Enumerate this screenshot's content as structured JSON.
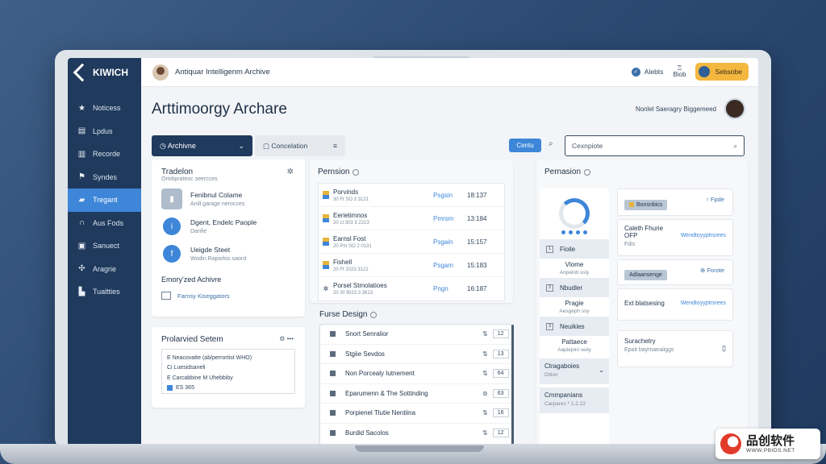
{
  "topbar": {
    "app_title": "Antiquar Intelligenm Archive",
    "link_label": "Alebts",
    "bell_label": "Biob",
    "pill_label": "Sebsobe"
  },
  "sidebar": {
    "logo": "KIWICH",
    "items": [
      {
        "label": "Noticess",
        "icon": "star-icon"
      },
      {
        "label": "Lpdus",
        "icon": "document-icon"
      },
      {
        "label": "Recorde",
        "icon": "book-icon"
      },
      {
        "label": "Syndes",
        "icon": "flag-icon"
      },
      {
        "label": "Tregant",
        "icon": "folder-icon",
        "active": true
      },
      {
        "label": "Aus Fods",
        "icon": "arch-icon"
      },
      {
        "label": "Sanuect",
        "icon": "calendar-icon"
      },
      {
        "label": "Aragrie",
        "icon": "settings-icon"
      },
      {
        "label": "Tualtties",
        "icon": "printer-icon"
      }
    ]
  },
  "header": {
    "title": "Arttimoorgy Archare",
    "user_text": "Nonlel Saeragry Biggemeed"
  },
  "toolbar": {
    "dropdown_label": "Archivne",
    "tab_label": "Concelation",
    "button_label": "Centu",
    "search_placeholder": "Cexnpiote"
  },
  "card_tradelon": {
    "title": "Tradelon",
    "subtitle": "Omitiprateoc seercces",
    "items": [
      {
        "title": "Fenibnul Colame",
        "sub": "Anill garage nerocces"
      },
      {
        "title": "Dgent, Endelc Paople",
        "sub": "Danfie"
      },
      {
        "title": "Ueigde Steet",
        "sub": "Wodin Raporlos saord"
      }
    ],
    "section_title": "Emory'zed Achivre",
    "footer": "Farnsy Kiseggators"
  },
  "card_system": {
    "title": "Prolarvied Setem",
    "more": "⚙ •••",
    "rows": [
      "E Neacovatte (ab/perrortist WHO)",
      "Ci Luesidsaneli",
      "E Carcabbine M Uhebbiby",
      "ES 365"
    ]
  },
  "permission": {
    "title": "Pernsion",
    "rows": [
      {
        "title": "Porvinds",
        "sub": "30 Ft SO 3 3121",
        "key": "Psgsin",
        "val": "18:137"
      },
      {
        "title": "Eerietimnos",
        "sub": "20 ct 303 3 2213",
        "key": "Pmrsm",
        "val": "13:184"
      },
      {
        "title": "Earnsl Fost",
        "sub": "20 Pm SO 2 0131",
        "key": "Psgain",
        "val": "15:157"
      },
      {
        "title": "Fishell",
        "sub": "20 Ft 2023 3121",
        "key": "Psgam",
        "val": "15:183"
      },
      {
        "title": "Porsel Stmolatioes",
        "sub": "20 Sf 3023 3 3613",
        "key": "Pngn",
        "val": "16:187"
      }
    ]
  },
  "features": {
    "title": "Furse Design",
    "rows": [
      {
        "label": "Snort Senralior",
        "n": "12"
      },
      {
        "label": "Stgiie Sevdos",
        "n": "13"
      },
      {
        "label": "Non Porcealy Iutnement",
        "n": "64"
      },
      {
        "label": "Eparumenn & The Sottinding",
        "n": "63"
      },
      {
        "label": "Porpienel Tlutie Nentiina",
        "n": "16"
      },
      {
        "label": "Burdid Sacolos",
        "n": "12"
      }
    ]
  },
  "permission2": {
    "title": "Pernasion",
    "left_items": [
      {
        "type": "sel",
        "n": "1",
        "label": "Fioile"
      },
      {
        "type": "sub",
        "label": "Vlome",
        "sub": "Anpeloti ssly"
      },
      {
        "type": "sel",
        "n": "2",
        "label": "Nbudler"
      },
      {
        "type": "sub",
        "label": "Pragie",
        "sub": "Aesgeph ssy"
      },
      {
        "type": "sel",
        "n": "3",
        "label": "Neuikies"
      },
      {
        "type": "sub",
        "label": "Pattaece",
        "sub": "Aapieplni seiiy"
      }
    ],
    "cat1": {
      "title": "Ctragaboies",
      "sub": "Dtlion"
    },
    "cat2": {
      "title": "Cmmpanians",
      "sub": "Carpares * 1.2.22"
    },
    "cards": [
      {
        "chip": "Bonsnbics",
        "action": "↑ Fpde"
      },
      {
        "head": "Caleth Fhurie OFP",
        "sub": "Fdis",
        "link": "Wendtoyyptrsrees"
      },
      {
        "chip": "Adlaansenge",
        "action": "⊕ Forote"
      },
      {
        "head": "Ext blatsesing",
        "link": "Wendtoyyptrsrees"
      },
      {
        "head": "Surachetry",
        "sub": "Epait bayrnaeaiiggs"
      }
    ]
  },
  "watermark": {
    "name": "品创软件",
    "url": "WWW.PBIDS.NET"
  }
}
